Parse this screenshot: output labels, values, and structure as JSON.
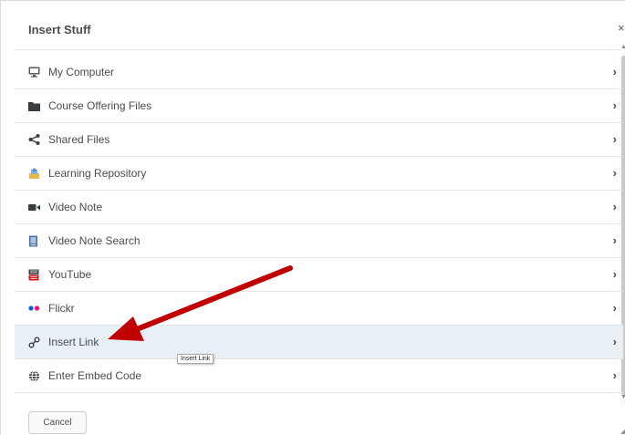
{
  "dialog": {
    "title": "Insert Stuff",
    "close_glyph": "×"
  },
  "items": [
    {
      "label": "My Computer",
      "icon": "computer-icon"
    },
    {
      "label": "Course Offering Files",
      "icon": "folder-icon"
    },
    {
      "label": "Shared Files",
      "icon": "share-icon"
    },
    {
      "label": "Learning Repository",
      "icon": "repository-icon"
    },
    {
      "label": "Video Note",
      "icon": "video-camera-icon"
    },
    {
      "label": "Video Note Search",
      "icon": "video-search-icon"
    },
    {
      "label": "YouTube",
      "icon": "youtube-icon"
    },
    {
      "label": "Flickr",
      "icon": "flickr-icon"
    },
    {
      "label": "Insert Link",
      "icon": "link-icon",
      "selected": true
    },
    {
      "label": "Enter Embed Code",
      "icon": "globe-icon"
    }
  ],
  "chevron_glyph": "›",
  "tooltip": "Insert Link",
  "footer": {
    "cancel_label": "Cancel"
  },
  "colors": {
    "arrow": "#c00000",
    "selected_bg": "#e8f0f6",
    "flickr_blue": "#0063dc",
    "flickr_pink": "#ff0084",
    "youtube_red": "#cc181e"
  }
}
